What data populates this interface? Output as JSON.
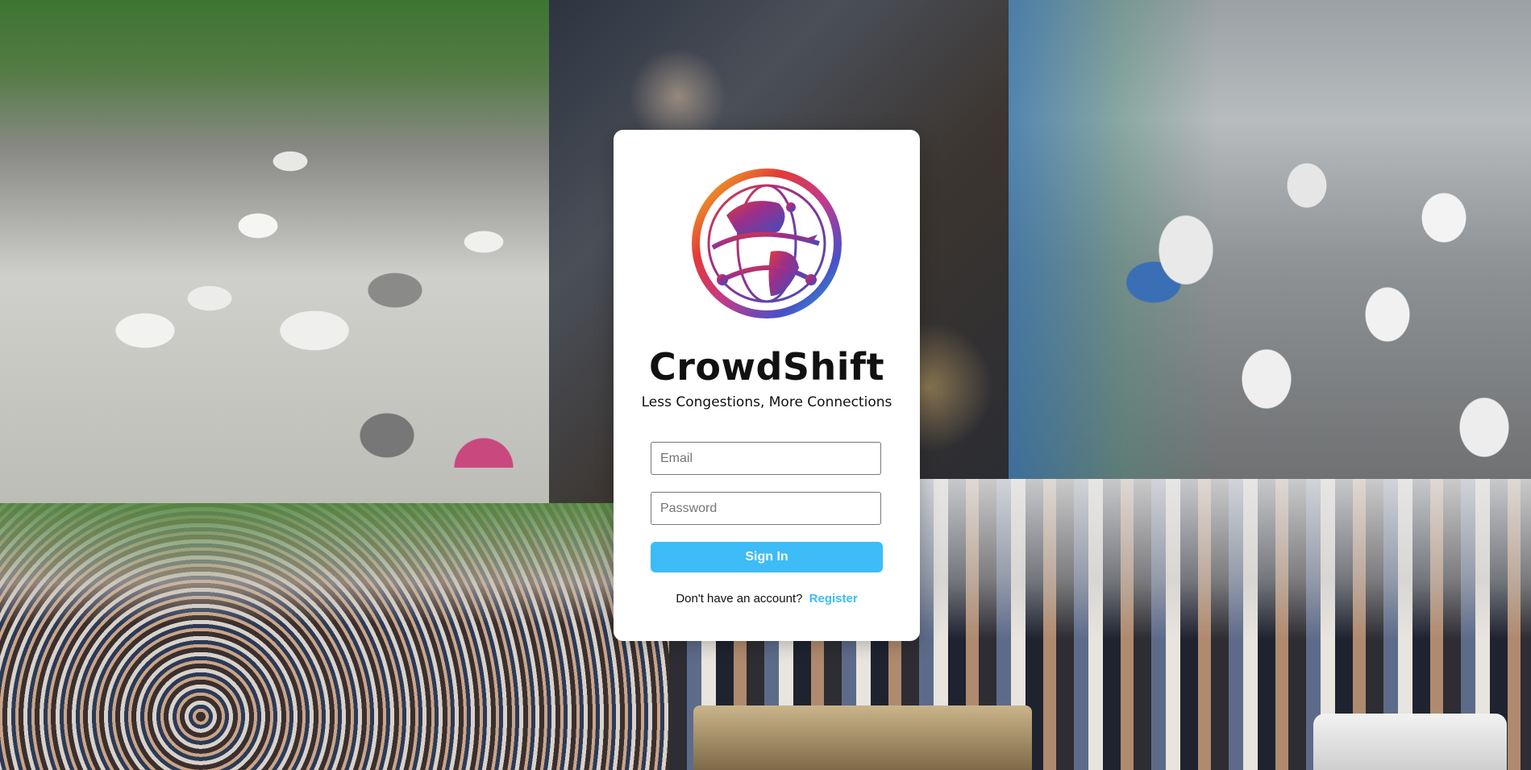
{
  "background": {
    "panels": [
      "traffic-street-photo",
      "market-crowd-photo",
      "city-traffic-photo",
      "festival-crowd-photo",
      "pedestrian-crossing-photo"
    ]
  },
  "login": {
    "logo_icon": "globe-logo-icon",
    "app_name": "CrowdShift",
    "tagline": "Less Congestions, More Connections",
    "email_placeholder": "Email",
    "password_placeholder": "Password",
    "signin_label": "Sign In",
    "register_prompt": "Don't have an account?",
    "register_label": "Register"
  },
  "colors": {
    "accent": "#3dbcf7",
    "card": "#ffffff"
  }
}
